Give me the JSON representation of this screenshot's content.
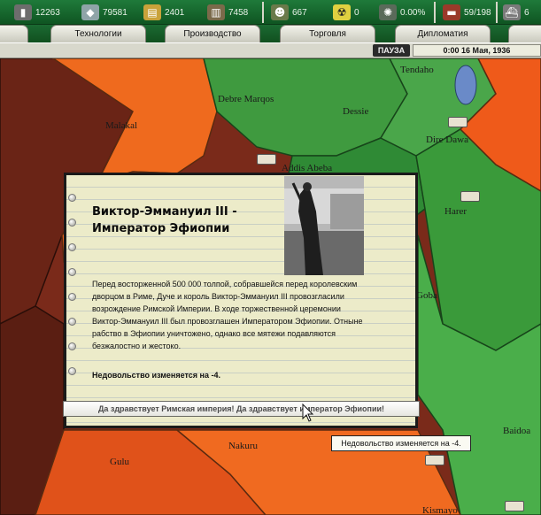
{
  "resources": [
    {
      "name": "energy",
      "icon": "energy-icon",
      "value": "12263",
      "color": "#6d6d6d"
    },
    {
      "name": "metal",
      "icon": "metal-icon",
      "value": "79581",
      "color": "#8fa4a8"
    },
    {
      "name": "rare",
      "icon": "rare-materials-icon",
      "value": "2401",
      "color": "#c9a23a"
    },
    {
      "name": "oil",
      "icon": "oil-icon",
      "value": "7458",
      "color": "#7a6a4a"
    },
    {
      "name": "manpower",
      "icon": "manpower-icon",
      "value": "667",
      "color": "#6a7a4a"
    },
    {
      "name": "nuclear",
      "icon": "nuclear-icon",
      "value": "0",
      "color": "#e0d040"
    },
    {
      "name": "dissent",
      "icon": "dissent-icon",
      "value": "0.00%",
      "color": "#5a6a5a"
    },
    {
      "name": "transport",
      "icon": "transport-icon",
      "value": "59/198",
      "color": "#9a3a2a"
    },
    {
      "name": "convoy",
      "icon": "convoy-icon",
      "value": "6",
      "color": "#7a7a7a"
    }
  ],
  "tabs": [
    {
      "label": "Технологии"
    },
    {
      "label": "Производство"
    },
    {
      "label": "Торговля"
    },
    {
      "label": "Дипломатия"
    }
  ],
  "status": {
    "pause": "ПАУЗА",
    "date": "0:00 16 Мая, 1936"
  },
  "map": {
    "places": [
      {
        "label": "Tendaho"
      },
      {
        "label": "Debre Marqos"
      },
      {
        "label": "Dessie"
      },
      {
        "label": "Malakal"
      },
      {
        "label": "Dire Dawa"
      },
      {
        "label": "Addis Abeba"
      },
      {
        "label": "Harer"
      },
      {
        "label": "Goba"
      },
      {
        "label": "Nakuru"
      },
      {
        "label": "Gulu"
      },
      {
        "label": "Baidoa"
      },
      {
        "label": "Kismayo"
      }
    ]
  },
  "event": {
    "title": "Виктор-Эммануил III - Император Эфиопии",
    "text": "Перед восторженной 500 000 толпой, собравшейся перед королевским дворцом в Риме, Дуче и король Виктор-Эммануил III провозгласили возрождение Римской Империи. В ходе торжественной церемонии Виктор-Эммануил III был провозглашен Императором Эфиопии. Отныне рабство в Эфиопии уничтожено, однако все мятежи подавляются безжалостно и жестоко.",
    "effect": "Недовольство изменяется на -4.",
    "button": "Да здравствует Римская империя! Да здравствует император Эфиопии!"
  },
  "tooltip": "Недовольство изменяется на -4."
}
